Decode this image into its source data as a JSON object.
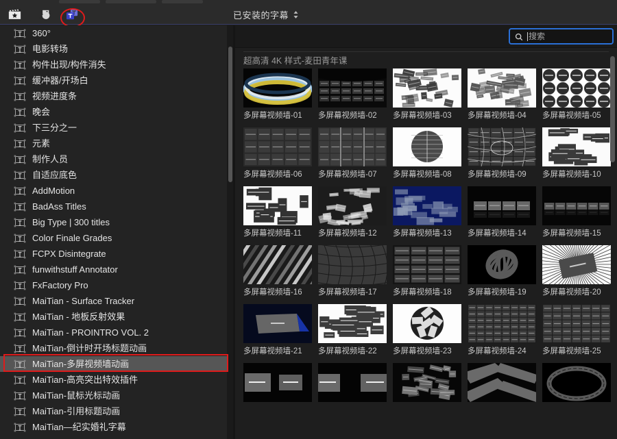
{
  "window": {
    "background": "#1e1e1e",
    "accent_blue": "#2a6fd6",
    "annotation_red": "#e01b1b",
    "selection_gray": "#565656"
  },
  "toolbar": {
    "icons": [
      {
        "name": "video-effects-icon",
        "glyph": "clapperboard",
        "active": false
      },
      {
        "name": "audio-photos-icon",
        "glyph": "music-photo",
        "active": false
      },
      {
        "name": "titles-generators-icon",
        "glyph": "titles-T",
        "active": true
      }
    ],
    "title": "已安装的字幕",
    "popup_indicator": "chevron-up-down"
  },
  "sidebar": {
    "items": [
      {
        "label": "360°"
      },
      {
        "label": "电影转场"
      },
      {
        "label": "构件出现/构件消失"
      },
      {
        "label": "缓冲器/开场白"
      },
      {
        "label": "视频进度条"
      },
      {
        "label": "晚会"
      },
      {
        "label": "下三分之一"
      },
      {
        "label": "元素"
      },
      {
        "label": "制作人员"
      },
      {
        "label": "自适应底色"
      },
      {
        "label": "AddMotion"
      },
      {
        "label": "BadAss Titles"
      },
      {
        "label": "Big Type | 300 titles"
      },
      {
        "label": "Color Finale Grades"
      },
      {
        "label": "FCPX Disintegrate"
      },
      {
        "label": "funwithstuff Annotator"
      },
      {
        "label": "FxFactory Pro"
      },
      {
        "label": "MaiTian -  Surface Tracker"
      },
      {
        "label": "MaiTian - 地板反射效果"
      },
      {
        "label": "MaiTian - PROINTRO VOL. 2"
      },
      {
        "label": "MaiTian-倒计时开场标题动画"
      },
      {
        "label": "MaiTian-多屏视频墙动画",
        "selected": true
      },
      {
        "label": "MaiTian-高亮突出特效插件"
      },
      {
        "label": "MaiTian-鼠标光标动画"
      },
      {
        "label": "MaiTian-引用标题动画"
      },
      {
        "label": "MaiTian—纪实婚礼字幕"
      }
    ]
  },
  "search": {
    "placeholder": "搜索",
    "value": "",
    "icon": "search-icon"
  },
  "browser": {
    "category_title": "超高清 4K 样式-麦田青年课",
    "items": [
      {
        "label": "多屏幕视频墙-01",
        "style": "ring-sky"
      },
      {
        "label": "多屏幕视频墙-02",
        "style": "curve-grid"
      },
      {
        "label": "多屏幕视频墙-03",
        "style": "scatter-white"
      },
      {
        "label": "多屏幕视频墙-04",
        "style": "scatter-white2"
      },
      {
        "label": "多屏幕视频墙-05",
        "style": "circles-white"
      },
      {
        "label": "多屏幕视频墙-06",
        "style": "rows-dark"
      },
      {
        "label": "多屏幕视频墙-07",
        "style": "rows-dark2"
      },
      {
        "label": "多屏幕视频墙-08",
        "style": "sphere-white"
      },
      {
        "label": "多屏幕视频墙-09",
        "style": "warp-grid"
      },
      {
        "label": "多屏幕视频墙-10",
        "style": "blocks-white"
      },
      {
        "label": "多屏幕视频墙-11",
        "style": "blocks-white2"
      },
      {
        "label": "多屏幕视频墙-12",
        "style": "tilt-scatter"
      },
      {
        "label": "多屏幕视频墙-13",
        "style": "blue-stack"
      },
      {
        "label": "多屏幕视频墙-14",
        "style": "arc-row"
      },
      {
        "label": "多屏幕视频墙-15",
        "style": "arc-row2"
      },
      {
        "label": "多屏幕视频墙-16",
        "style": "diag-stripes"
      },
      {
        "label": "多屏幕视频墙-17",
        "style": "wave-grid"
      },
      {
        "label": "多屏幕视频墙-18",
        "style": "tiles-4x4"
      },
      {
        "label": "多屏幕视频墙-19",
        "style": "sphere-dark"
      },
      {
        "label": "多屏幕视频墙-20",
        "style": "card-rays"
      },
      {
        "label": "多屏幕视频墙-21",
        "style": "card-blue"
      },
      {
        "label": "多屏幕视频墙-22",
        "style": "blocks-white3"
      },
      {
        "label": "多屏幕视频墙-23",
        "style": "ball-white"
      },
      {
        "label": "多屏幕视频墙-24",
        "style": "dense-grid"
      },
      {
        "label": "多屏幕视频墙-25",
        "style": "dense-grid2"
      },
      {
        "label": "",
        "style": "two-cards"
      },
      {
        "label": "",
        "style": "two-cards2"
      },
      {
        "label": "",
        "style": "float-dark"
      },
      {
        "label": "",
        "style": "ribbons"
      },
      {
        "label": "",
        "style": "ring-dark"
      }
    ]
  }
}
